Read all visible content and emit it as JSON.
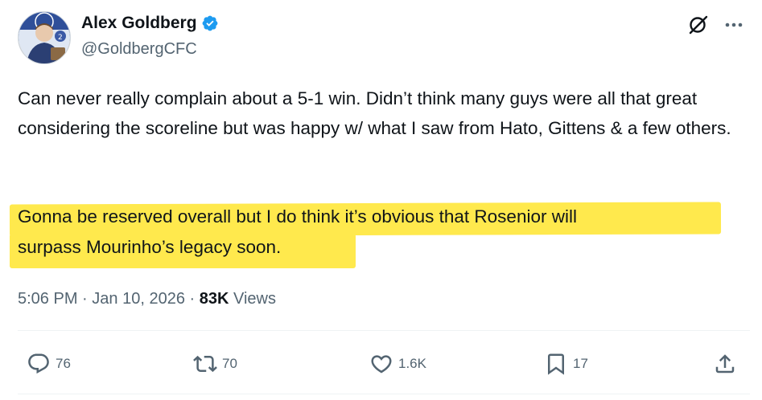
{
  "author": {
    "display_name": "Alex Goldberg",
    "handle": "@GoldbergCFC",
    "verified": true,
    "accent_color": "#1d9bf0"
  },
  "tweet": {
    "paragraph_1": "Can never really complain about a 5-1 win. Didn’t think many guys were all that great considering the scoreline but was happy w/ what I saw from Hato, Gittens & a few others.",
    "highlight_line_1": "Gonna be reserved overall but I do think it’s obvious that Rosenior will",
    "highlight_line_2": "surpass Mourinho’s legacy soon.",
    "highlight_color": "#ffe94d"
  },
  "meta": {
    "time": "5:06 PM",
    "separator": "·",
    "date": "Jan 10, 2026",
    "views_count": "83K",
    "views_label": "Views"
  },
  "actions": {
    "reply_count": "76",
    "repost_count": "70",
    "like_count": "1.6K",
    "bookmark_count": "17"
  },
  "icons": {
    "verified": "verified-badge-icon",
    "grok": "grok-icon",
    "more": "more-options-icon",
    "reply": "reply-icon",
    "repost": "repost-icon",
    "like": "heart-icon",
    "bookmark": "bookmark-icon",
    "share": "share-icon"
  }
}
